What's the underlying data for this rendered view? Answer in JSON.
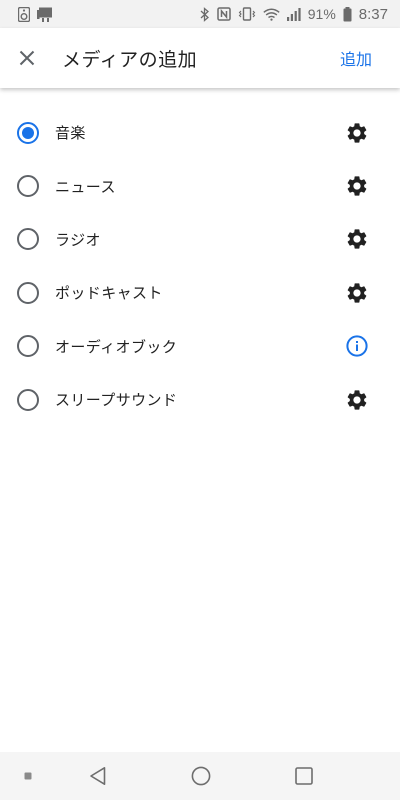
{
  "status_bar": {
    "battery_percent": "91%",
    "time": "8:37",
    "icons": [
      "speaker-icon",
      "notification-card-icon",
      "bluetooth-icon",
      "nfc-icon",
      "vibrate-icon",
      "wifi-icon",
      "signal-icon",
      "battery-icon"
    ]
  },
  "app_bar": {
    "title": "メディアの追加",
    "action_label": "追加",
    "close_icon": "close-icon"
  },
  "media_options": [
    {
      "label": "音楽",
      "selected": true,
      "action_icon": "gear-icon"
    },
    {
      "label": "ニュース",
      "selected": false,
      "action_icon": "gear-icon"
    },
    {
      "label": "ラジオ",
      "selected": false,
      "action_icon": "gear-icon"
    },
    {
      "label": "ポッドキャスト",
      "selected": false,
      "action_icon": "gear-icon"
    },
    {
      "label": "オーディオブック",
      "selected": false,
      "action_icon": "info-icon"
    },
    {
      "label": "スリープサウンド",
      "selected": false,
      "action_icon": "gear-icon"
    }
  ],
  "colors": {
    "accent": "#1a73e8",
    "icon": "#212121",
    "radio_unchecked": "#5f6368"
  },
  "nav_bar": {
    "buttons": [
      "menu-dot-icon",
      "back-icon",
      "home-icon",
      "recents-icon"
    ]
  }
}
